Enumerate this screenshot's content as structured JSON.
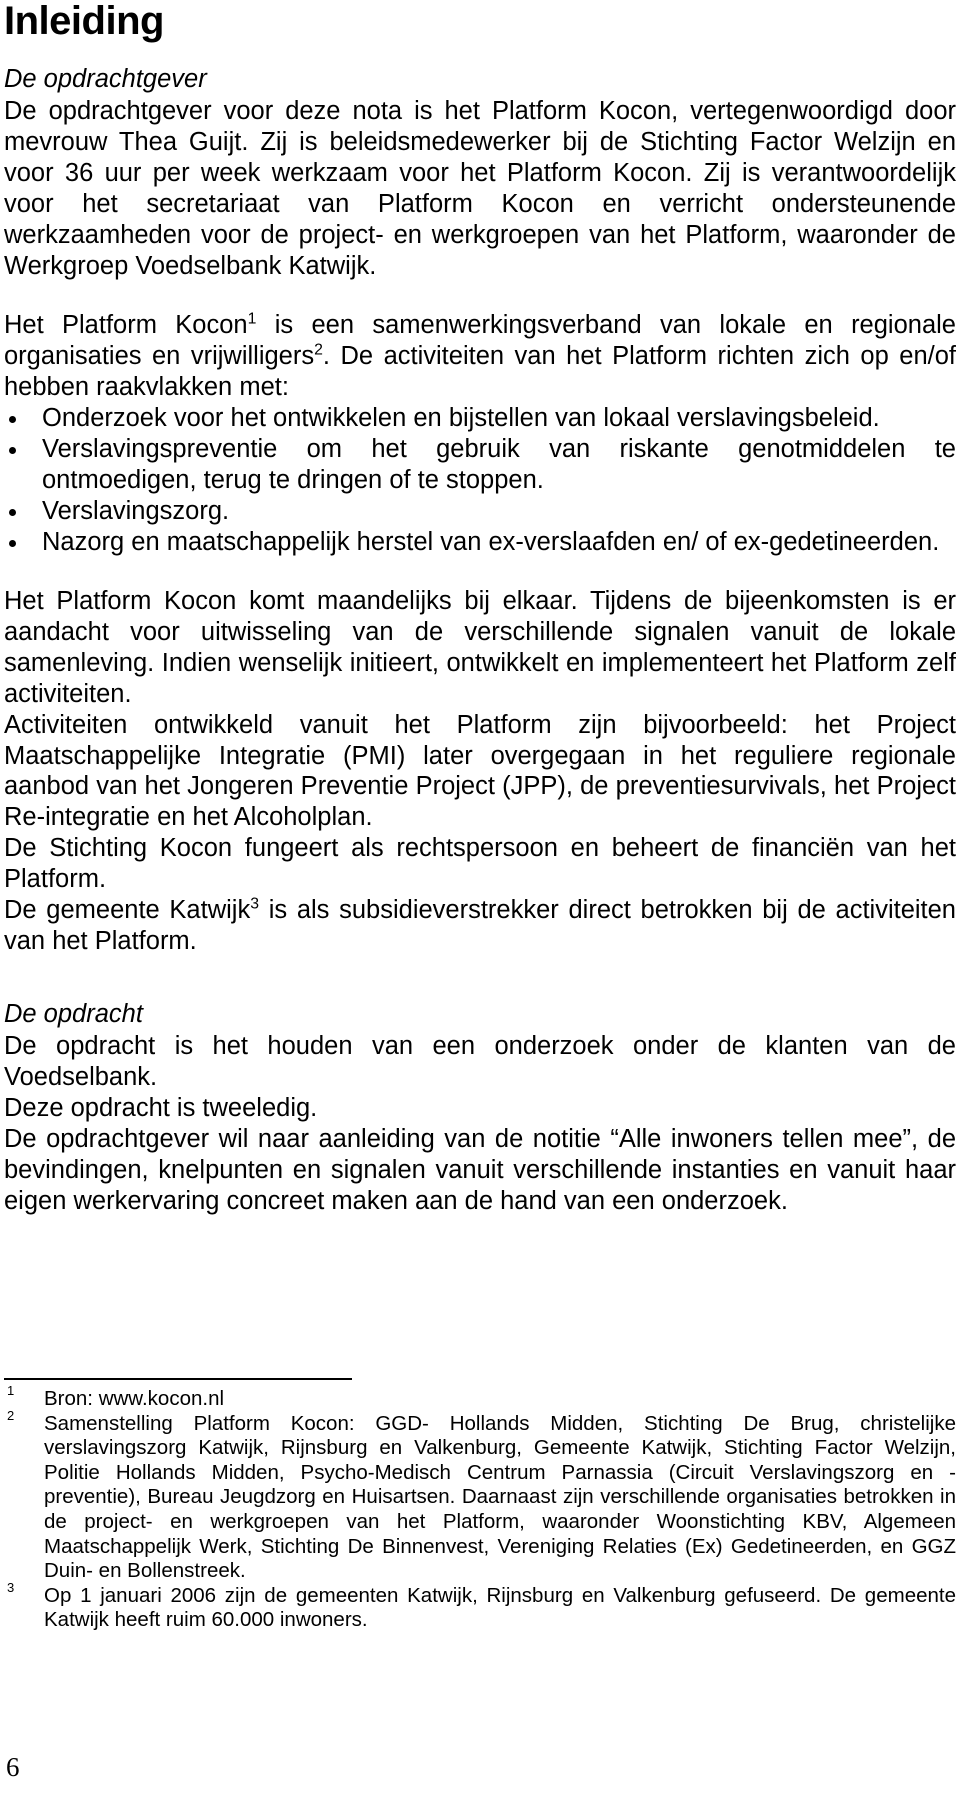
{
  "document": {
    "title": "Inleiding",
    "page_number": "6",
    "sections": [
      {
        "heading": "De opdrachtgever",
        "paragraphs": [
          "De opdrachtgever voor deze nota is het Platform Kocon, vertegenwoordigd door mevrouw Thea Guijt. Zij is beleidsmedewerker bij de Stichting Factor Welzijn en voor 36 uur per week werkzaam voor het Platform Kocon. Zij is verantwoordelijk voor het secretariaat van Platform Kocon en verricht ondersteunende werkzaamheden voor de project- en werkgroepen van het Platform, waaronder de Werkgroep Voedselbank Katwijk."
        ]
      },
      {
        "heading": "De opdracht",
        "paragraphs": [
          "De opdracht is het houden van een onderzoek onder de klanten van de Voedselbank.",
          "Deze opdracht is tweeledig.",
          "De opdrachtgever wil naar aanleiding van de notitie “Alle inwoners tellen mee”, de bevindingen, knelpunten en signalen vanuit verschillende instanties en vanuit haar eigen werkervaring concreet maken aan de hand van een onderzoek."
        ]
      }
    ],
    "platform_intro": {
      "lead_before_sup1": "Het Platform Kocon",
      "sup1": "1",
      "lead_between": " is een samenwerkingsverband van lokale en regionale organisaties en vrijwilligers",
      "sup2": "2",
      "lead_after": ". De activiteiten van het Platform richten zich op en/of hebben raakvlakken met:"
    },
    "bullets": [
      "Onderzoek voor het ontwikkelen en bijstellen van lokaal verslavingsbeleid.",
      "Verslavingspreventie om het gebruik van riskante genotmiddelen te ontmoedigen, terug te dringen of te stoppen.",
      "Verslavingszorg.",
      "Nazorg en maatschappelijk herstel van ex-verslaafden en/ of ex-gedetineerden."
    ],
    "paragraphs_after_bullets": [
      "Het Platform Kocon komt maandelijks bij elkaar. Tijdens de bijeenkomsten is er aandacht voor uitwisseling van de verschillende signalen vanuit de lokale samenleving. Indien wenselijk initieert, ontwikkelt en implementeert het Platform zelf activiteiten.",
      "Activiteiten ontwikkeld vanuit het Platform zijn bijvoorbeeld: het Project Maatschappelijke Integratie (PMI) later overgegaan in het reguliere regionale aanbod van het Jongeren Preventie Project (JPP), de preventiesurvivals, het Project Re-integratie en het Alcoholplan.",
      "De Stichting Kocon fungeert als rechtspersoon en beheert de financiën van het Platform."
    ],
    "gemeente_paragraph": {
      "before_sup": "De gemeente Katwijk",
      "sup": "3",
      "after_sup": " is als subsidieverstrekker direct betrokken bij de activiteiten van het Platform."
    },
    "footnotes": [
      {
        "number": "1",
        "text": "Bron: www.kocon.nl"
      },
      {
        "number": "2",
        "text": "Samenstelling Platform Kocon: GGD- Hollands Midden, Stichting De Brug, christelijke verslavingszorg Katwijk, Rijnsburg en Valkenburg, Gemeente Katwijk, Stichting Factor Welzijn, Politie Hollands Midden, Psycho-Medisch Centrum Parnassia (Circuit Verslavingszorg en -preventie), Bureau Jeugdzorg en Huisartsen. Daarnaast zijn verschillende organisaties betrokken in de project- en werkgroepen van het Platform, waaronder Woonstichting KBV, Algemeen Maatschappelijk Werk, Stichting De Binnenvest, Vereniging Relaties (Ex) Gedetineerden, en GGZ Duin- en Bollenstreek."
      },
      {
        "number": "3",
        "text": "Op 1 januari 2006 zijn de gemeenten Katwijk, Rijnsburg en Valkenburg gefuseerd. De gemeente Katwijk heeft ruim 60.000 inwoners."
      }
    ]
  }
}
